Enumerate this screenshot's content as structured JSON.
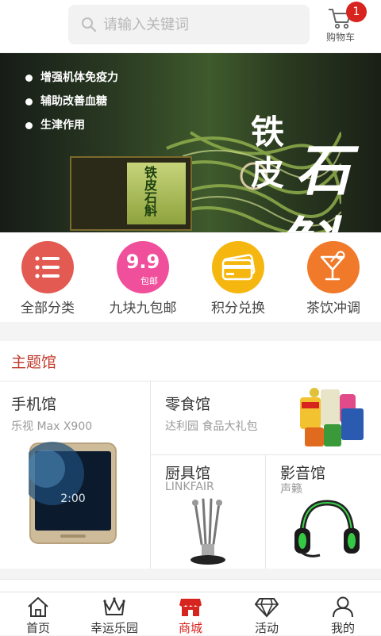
{
  "search": {
    "placeholder": "请输入关键词"
  },
  "cart": {
    "label": "购物车",
    "badge": "1"
  },
  "banner": {
    "bullets": [
      "增强机体免疫力",
      "辅助改善血糖",
      "生津作用"
    ],
    "title_chars": [
      "铁",
      "皮",
      "石",
      "斛"
    ],
    "box_label": "铁皮石斛",
    "slides": 4,
    "active_slide": 0
  },
  "quick_menu": [
    {
      "label": "全部分类",
      "icon": "list-icon",
      "color": "#e25a52"
    },
    {
      "label": "九块九包邮",
      "icon": "nine-nine-badge-icon",
      "color": "#f0509b",
      "badge_text": "9.9",
      "badge_sub": "包邮"
    },
    {
      "label": "积分兑换",
      "icon": "card-icon",
      "color": "#f5b70f"
    },
    {
      "label": "茶饮冲调",
      "icon": "cocktail-icon",
      "color": "#f17a2a"
    }
  ],
  "theme": {
    "title": "主题馆",
    "tiles": [
      {
        "title": "手机馆",
        "subtitle": "乐视 Max X900",
        "image": "phone-image",
        "screen_time": "2:00"
      },
      {
        "title": "零食馆",
        "subtitle": "达利园 食品大礼包",
        "image": "snacks-image"
      },
      {
        "title": "厨具馆",
        "subtitle": "LINKFAIR",
        "image": "kitchen-knives-image"
      },
      {
        "title": "影音馆",
        "subtitle": "声籁",
        "image": "headphones-image"
      }
    ]
  },
  "nav": {
    "items": [
      {
        "label": "首页",
        "icon": "home-icon"
      },
      {
        "label": "幸运乐园",
        "icon": "crown-icon"
      },
      {
        "label": "商城",
        "icon": "shop-icon"
      },
      {
        "label": "活动",
        "icon": "diamond-icon"
      },
      {
        "label": "我的",
        "icon": "user-icon"
      }
    ],
    "active": "商城"
  },
  "colors": {
    "accent": "#d8241e",
    "section_title": "#c0392b"
  }
}
